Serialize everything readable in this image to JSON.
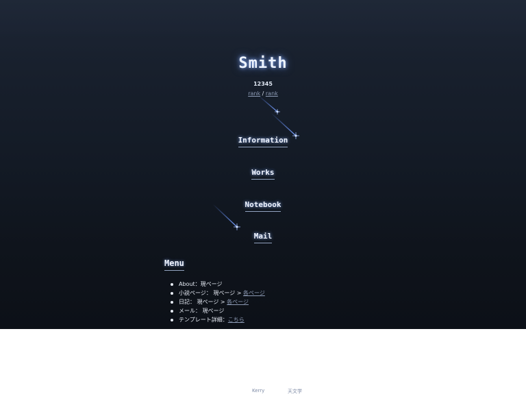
{
  "site": {
    "title": "Smith",
    "counter": "12345",
    "rank_links": [
      "rank",
      "rank"
    ],
    "rank_separator": " / "
  },
  "nav": {
    "items": [
      {
        "label": "Information"
      },
      {
        "label": "Works"
      },
      {
        "label": "Notebook"
      },
      {
        "label": "Mail"
      }
    ]
  },
  "menu": {
    "heading": "Menu",
    "items": [
      {
        "text": "About：現ページ",
        "link": ""
      },
      {
        "text": "小説ページ： 現ページ > ",
        "link": "各ページ"
      },
      {
        "text": "日記： 現ページ > ",
        "link": "各ページ"
      },
      {
        "text": "メール： 現ページ",
        "link": ""
      },
      {
        "text": "テンプレート詳細：",
        "link": "こちら"
      }
    ]
  },
  "footer": {
    "links": [
      "Kerry",
      "天文学"
    ]
  },
  "colors": {
    "hero_top": "#1d2635",
    "hero_bottom": "#0c1017",
    "title_glow": "#8cb4ff",
    "link_muted": "#8d9bb5",
    "star_streak": "#5f8cff"
  },
  "icons": {
    "decoration": "shooting-star-icon"
  }
}
